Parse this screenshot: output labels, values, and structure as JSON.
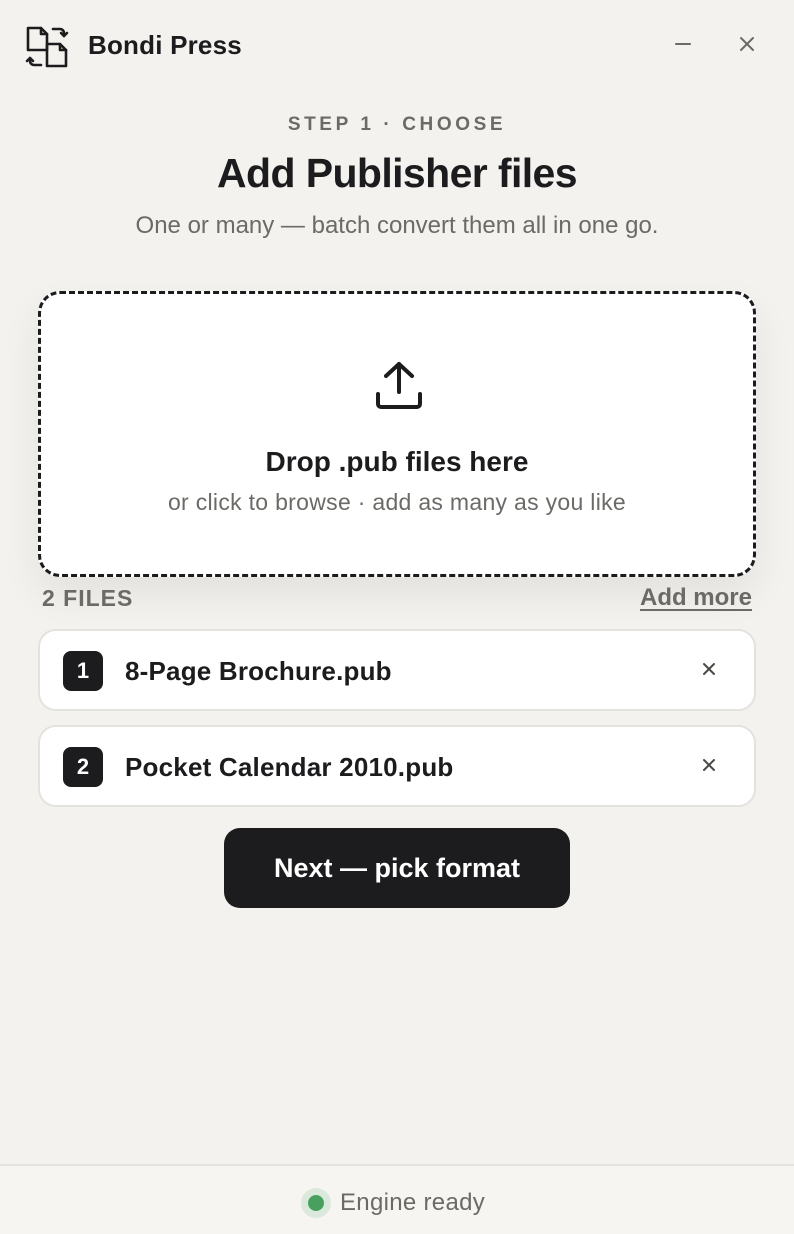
{
  "app": {
    "name": "Bondi Press",
    "icon": "file-convert-icon"
  },
  "window_controls": {
    "minimize_icon": "minimize-icon",
    "close_icon": "close-icon"
  },
  "step": {
    "eyebrow": "STEP 1 · CHOOSE",
    "title": "Add Publisher files",
    "subtitle": "One or many — batch convert them all in one go."
  },
  "dropzone": {
    "icon": "upload-icon",
    "title": "Drop .pub files here",
    "subtitle": "or click to browse · add as many as you like"
  },
  "files": {
    "count_label": "2 FILES",
    "add_more_label": "Add more",
    "items": [
      {
        "index": "1",
        "name": "8-Page Brochure.pub",
        "remove_icon": "remove-icon"
      },
      {
        "index": "2",
        "name": "Pocket Calendar 2010.pub",
        "remove_icon": "remove-icon"
      }
    ]
  },
  "actions": {
    "next_label": "Next — pick format"
  },
  "status": {
    "text": "Engine ready",
    "color": "#47a05d"
  },
  "colors": {
    "background": "#f3f2ee",
    "primary": "#1c1c1e",
    "muted_text": "#6b6a66",
    "border": "#e4e2dc"
  }
}
